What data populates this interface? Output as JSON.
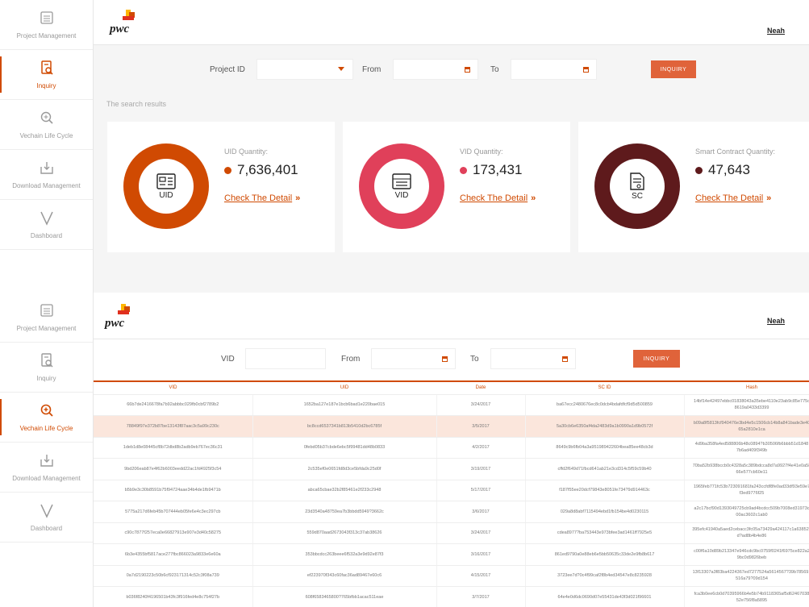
{
  "brand": {
    "logo_text": "pwc",
    "accent": "#d04a02"
  },
  "user": {
    "name": "Neah"
  },
  "sidebar": {
    "items": [
      {
        "label": "Project Management",
        "icon": "project-list-icon"
      },
      {
        "label": "Inquiry",
        "icon": "inquiry-search-icon"
      },
      {
        "label": "Vechain Life Cycle",
        "icon": "life-cycle-search-icon"
      },
      {
        "label": "Download Management",
        "icon": "download-icon"
      },
      {
        "label": "Dashboard",
        "icon": "vechain-v-icon"
      }
    ]
  },
  "inquiry_screen": {
    "filter": {
      "project_id_label": "Project ID",
      "from_label": "From",
      "to_label": "To",
      "inquiry_button": "INQUIRY"
    },
    "results_title": "The search results",
    "cards": [
      {
        "label": "UID Quantity:",
        "value": "7,636,401",
        "abbr": "UID",
        "detail": "Check The Detail",
        "color": "#d04a02",
        "icon": "id-card-icon"
      },
      {
        "label": "VID Quantity:",
        "value": "173,431",
        "abbr": "VID",
        "detail": "Check The Detail",
        "color": "#e0405a",
        "icon": "vechain-card-icon"
      },
      {
        "label": "Smart Contract Quantity:",
        "value": "47,643",
        "abbr": "SC",
        "detail": "Check The Detail",
        "color": "#5e1a1c",
        "icon": "contract-document-icon"
      }
    ]
  },
  "lifecycle_screen": {
    "filter": {
      "vid_label": "VID",
      "from_label": "From",
      "to_label": "To",
      "inquiry_button": "INQUIRY"
    },
    "table": {
      "columns": [
        "VID",
        "UID",
        "Date",
        "SC ID",
        "Hash"
      ],
      "rows": [
        {
          "vid": "66b7de2416678fa7b92abbbc029fb0cbf2789b2",
          "uid": "1652ba127e187e1bcb6bad1e220bae015",
          "date": "3/24/2017",
          "scid": "ba67ecc2480676ec8c0dcb4bdafdfcf9d5d500859",
          "hash_1": "14bf14e42497ebbc01838043a35ebe4110e23ab9c85e775c",
          "hash_2": "8619a0433d3399"
        },
        {
          "vid": "78849f97e372b87be13143f87aac3c5a99c230c",
          "uid": "bc8ccd6537341b813b5410d2bc6785f",
          "date": "3/5/2017",
          "scid": "5a30cb6e6350af4da2483d9a1b0990a1d9b0572f",
          "hash_1": "b09a8f5813fcf940476e3bd4e5c1506cb14b8a841bade3e40",
          "hash_2": "65a2810e1ca"
        },
        {
          "vid": "1deb1d8e08445cf8b72dbd8b2adb9eb767ec36c31",
          "uid": "0febd05b37cbde6ebc5f99481dd48b0833",
          "date": "4/2/2017",
          "scid": "8649c9b6fb04a3a951989422604bea85ee48cb3d",
          "hash_1": "4d9ba358fa4ed588806b48c0894?b30506fb6bbb51d1848",
          "hash_2": "7b6ad409f349b"
        },
        {
          "vid": "9bd206eab87e4f62b6003eedd22ac1fd4925f3c54",
          "uid": "2c535ef0e0651fd8d3ce5bfda9c25d0f",
          "date": "3/19/2017",
          "scid": "cffd2f649d71fbcd641ab21e3cd314c5f59c59b40",
          "hash_1": "70ba52b938bccb0c4328a5c389bdcca8d7a9927f4e41e0a58",
          "hash_2": "66e577cb60e11"
        },
        {
          "vid": "b5b9e3c30b8591b75f94724aae34b4de1fb9471b",
          "uid": "abca65cbae32b2f85461e2f233c2948",
          "date": "5/17/2017",
          "scid": "f187f55ee20dcf79843e8051fe734?9d914463c",
          "hash_1": "1965feb771fc53b723091681fa243ccfdf8fe0ad33df93e59e7",
          "hash_2": "f3ed9776f25"
        },
        {
          "vid": "5775a217d6feb45b707444eb05fe6e4c3ec297cb",
          "uid": "23d3540a48759ea7b3bbdd5949?3662c",
          "date": "3/6/2017",
          "scid": "029a8d8abf7115494ebd1fb154be4d0230115",
          "hash_1": "a2c17bcf90d1393049725cb9ad4bcdcc509b7008ed31973c",
          "hash_2": "00ac3602c1ab0"
        },
        {
          "vid": "c90c7877f257eca0e6682?913e907e3d40c58275",
          "uid": "559d870aad2673043f313c37ab38626",
          "date": "3/24/2017",
          "scid": "cdea8977?ba753443e973bfee3ad1461ff7925e5",
          "hash_1": "395efc41940a5aed2cebacc3fc05a73429a424117c1a63852b",
          "hash_2": "d?ad8b4b4e86"
        },
        {
          "vid": "6b3e4355bf5817ace277fbc866023a9833e6e60a",
          "uid": "353bbcdcc263beee6f532a3e9d92e87f3",
          "date": "3/16/2017",
          "scid": "861ed9790a0e88eb6e5bb50635c33de2e9fb8b617",
          "hash_1": "c00f6a10d89b213347e946cdc9bc0759f0241f6975ce822a2",
          "hash_2": "9bc0d9826beb"
        },
        {
          "vid": "0a7d2190223c50b6cf923171314c52c3f08a739",
          "uid": "ef223970f343c60fac36ad89467e60c6",
          "date": "4/15/2017",
          "scid": "3723ee7d?0c4f99caf2f8b4ed34547e8c8235928",
          "hash_1": "13f13307a3f83ba4224367ed7277524a5614567?39b785691",
          "hash_2": "516a79?09d154"
        },
        {
          "vid": "b036f8240f4196501b43fc3f916fed4e8c754f27b",
          "uid": "608f6583465800?765bfbb1acac511eae",
          "date": "3/7/2017",
          "scid": "64e4e0d6dc0690d07e55431de43f3d021f96601",
          "hash_1": "fca3b0ee6cb0d70395966b4e5b74b9118365af5d62467038",
          "hash_2": "52e756f8a5895"
        }
      ]
    }
  }
}
